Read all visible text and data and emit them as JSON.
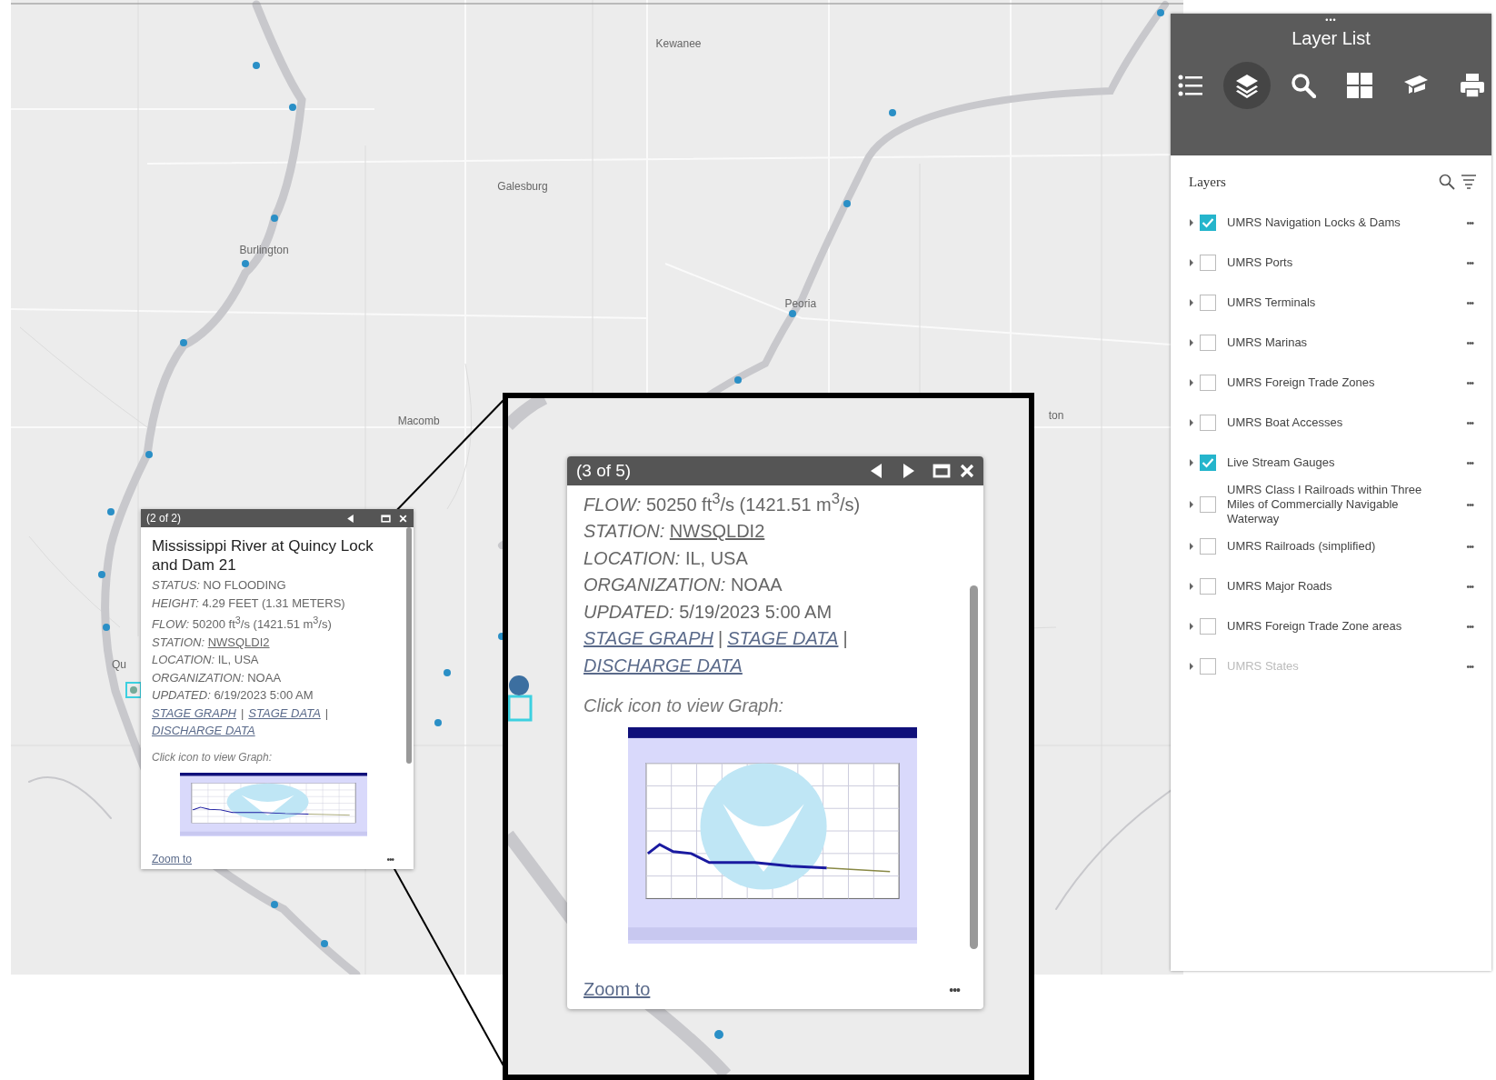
{
  "map": {
    "place_labels": [
      {
        "text": "Kewanee"
      },
      {
        "text": "Galesburg"
      },
      {
        "text": "Burlington"
      },
      {
        "text": "Peoria"
      },
      {
        "text": "Macomb"
      },
      {
        "text": "ton"
      },
      {
        "text": "Qu"
      }
    ]
  },
  "popup": {
    "counter": "(2 of 2)",
    "controls": [
      {
        "kind": "prev"
      },
      {
        "kind": "maximize"
      },
      {
        "kind": "close"
      }
    ],
    "title": "Mississippi River at Quincy Lock and Dam 21",
    "fields": [
      {
        "label": "STATUS:",
        "value": "NO FLOODING",
        "kind": "text"
      },
      {
        "label": "HEIGHT:",
        "value": "4.29 FEET (1.31 METERS)",
        "kind": "text"
      },
      {
        "label": "FLOW:",
        "value": "50200 ft$^{3}$/s (1421.51 m$^{3}$/s)",
        "kind": "text"
      },
      {
        "label": "STATION:",
        "value": "NWSQLDI2",
        "kind": "link"
      },
      {
        "label": "LOCATION:",
        "value": "IL, USA",
        "kind": "text"
      },
      {
        "label": "ORGANIZATION:",
        "value": "NOAA",
        "kind": "text"
      },
      {
        "label": "UPDATED:",
        "value": "6/19/2023 5:00 AM",
        "kind": "text"
      }
    ],
    "links": [
      {
        "text": "STAGE GRAPH",
        "separator": "|"
      },
      {
        "text": "STAGE DATA",
        "separator": "|"
      },
      {
        "text": "DISCHARGE DATA"
      }
    ],
    "graph_caption": "Click icon to view Graph:",
    "zoom_link": "Zoom to",
    "more": "•••"
  },
  "inset_popup": {
    "counter": "(3 of 5)",
    "controls": [
      {
        "kind": "prev"
      },
      {
        "kind": "next"
      },
      {
        "kind": "maximize"
      },
      {
        "kind": "close"
      }
    ],
    "fields": [
      {
        "label": "FLOW:",
        "value": "50250 ft$^{3}$/s (1421.51 m$^{3}$/s)",
        "kind": "text"
      },
      {
        "label": "STATION:",
        "value": "NWSQLDI2",
        "kind": "link"
      },
      {
        "label": "LOCATION:",
        "value": "IL, USA",
        "kind": "text"
      },
      {
        "label": "ORGANIZATION:",
        "value": "NOAA",
        "kind": "text"
      },
      {
        "label": "UPDATED:",
        "value": "5/19/2023 5:00 AM",
        "kind": "text"
      }
    ],
    "links": [
      {
        "text": "STAGE GRAPH",
        "separator": "|"
      },
      {
        "text": "STAGE DATA",
        "separator": "|"
      },
      {
        "text": "DISCHARGE DATA"
      }
    ],
    "graph_caption": "Click icon to view Graph:",
    "zoom_link": "Zoom to",
    "more": "•••"
  },
  "layer_list": {
    "handle": "•••",
    "title": "Layer List",
    "tools": [
      {
        "kind": "list",
        "selected": false
      },
      {
        "kind": "layers",
        "selected": true
      },
      {
        "kind": "search",
        "selected": false
      },
      {
        "kind": "grid",
        "selected": false
      },
      {
        "kind": "cap",
        "selected": false
      },
      {
        "kind": "print",
        "selected": false
      }
    ],
    "section_title": "Layers",
    "layers": [
      {
        "name": "UMRS Navigation Locks & Dams",
        "checked": true,
        "disabled": false
      },
      {
        "name": "UMRS Ports",
        "checked": false,
        "disabled": false
      },
      {
        "name": "UMRS Terminals",
        "checked": false,
        "disabled": false
      },
      {
        "name": "UMRS Marinas",
        "checked": false,
        "disabled": false
      },
      {
        "name": "UMRS Foreign Trade Zones",
        "checked": false,
        "disabled": false
      },
      {
        "name": "UMRS Boat Accesses",
        "checked": false,
        "disabled": false
      },
      {
        "name": "Live Stream Gauges",
        "checked": true,
        "disabled": false
      },
      {
        "name": "UMRS Class I Railroads within Three Miles of Commercially Navigable Waterway",
        "checked": false,
        "disabled": false
      },
      {
        "name": "UMRS Railroads (simplified)",
        "checked": false,
        "disabled": false
      },
      {
        "name": "UMRS Major Roads",
        "checked": false,
        "disabled": false
      },
      {
        "name": "UMRS Foreign Trade Zone areas",
        "checked": false,
        "disabled": false
      },
      {
        "name": "UMRS States",
        "checked": false,
        "disabled": true
      }
    ],
    "more": "•••"
  }
}
